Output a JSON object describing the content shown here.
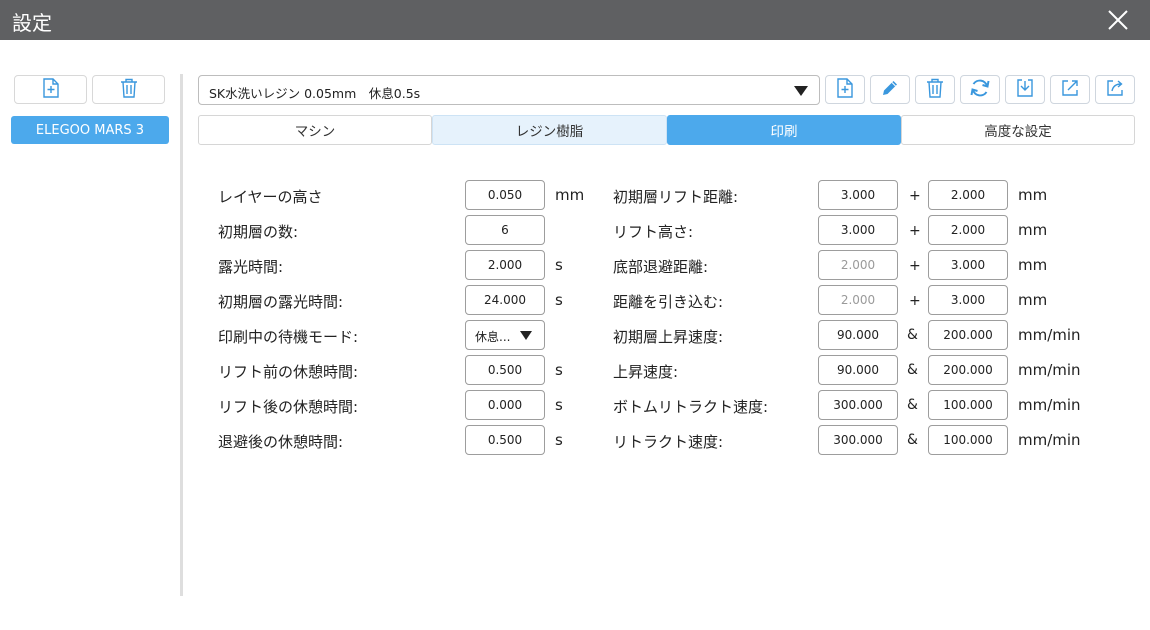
{
  "window": {
    "title": "設定",
    "close_icon": "close-icon"
  },
  "colors": {
    "titlebar": "#5f6062",
    "accent": "#4ca9ec",
    "tab_light": "#e6f2fc"
  },
  "sidebar": {
    "add_icon": "add-file-icon",
    "delete_icon": "trash-icon",
    "printers": [
      {
        "label": "ELEGOO MARS 3",
        "selected": true
      }
    ]
  },
  "preset": {
    "value": "SK水洗いレジン 0.05mm　休息0.5s"
  },
  "toolbar": {
    "icons": [
      "add-file-icon",
      "edit-icon",
      "trash-icon",
      "refresh-icon",
      "import-icon",
      "export-icon",
      "share-icon"
    ]
  },
  "tabs": [
    {
      "label": "マシン",
      "state": "normal"
    },
    {
      "label": "レジン樹脂",
      "state": "hover"
    },
    {
      "label": "印刷",
      "state": "active"
    },
    {
      "label": "高度な設定",
      "state": "normal"
    }
  ],
  "left_settings": [
    {
      "label": "レイヤーの高さ",
      "value": "0.050",
      "unit": "mm"
    },
    {
      "label": "初期層の数:",
      "value": "6",
      "unit": ""
    },
    {
      "label": "露光時間:",
      "value": "2.000",
      "unit": "s"
    },
    {
      "label": "初期層の露光時間:",
      "value": "24.000",
      "unit": "s"
    },
    {
      "label": "印刷中の待機モード:",
      "value": "休息...",
      "unit": ""
    },
    {
      "label": "リフト前の休憩時間:",
      "value": "0.500",
      "unit": "s"
    },
    {
      "label": "リフト後の休憩時間:",
      "value": "0.000",
      "unit": "s"
    },
    {
      "label": "退避後の休憩時間:",
      "value": "0.500",
      "unit": "s"
    }
  ],
  "right_settings": [
    {
      "label": "初期層リフト距離:",
      "value1": "3.000",
      "op": "+",
      "value2": "2.000",
      "unit": "mm"
    },
    {
      "label": "リフト高さ:",
      "value1": "3.000",
      "op": "+",
      "value2": "2.000",
      "unit": "mm"
    },
    {
      "label": "底部退避距離:",
      "value1": "2.000",
      "op": "+",
      "value2": "3.000",
      "unit": "mm"
    },
    {
      "label": "距離を引き込む:",
      "value1": "2.000",
      "op": "+",
      "value2": "3.000",
      "unit": "mm"
    },
    {
      "label": "初期層上昇速度:",
      "value1": "90.000",
      "op": "&",
      "value2": "200.000",
      "unit": "mm/min"
    },
    {
      "label": "上昇速度:",
      "value1": "90.000",
      "op": "&",
      "value2": "200.000",
      "unit": "mm/min"
    },
    {
      "label": "ボトムリトラクト速度:",
      "value1": "300.000",
      "op": "&",
      "value2": "100.000",
      "unit": "mm/min"
    },
    {
      "label": "リトラクト速度:",
      "value1": "300.000",
      "op": "&",
      "value2": "100.000",
      "unit": "mm/min"
    }
  ]
}
